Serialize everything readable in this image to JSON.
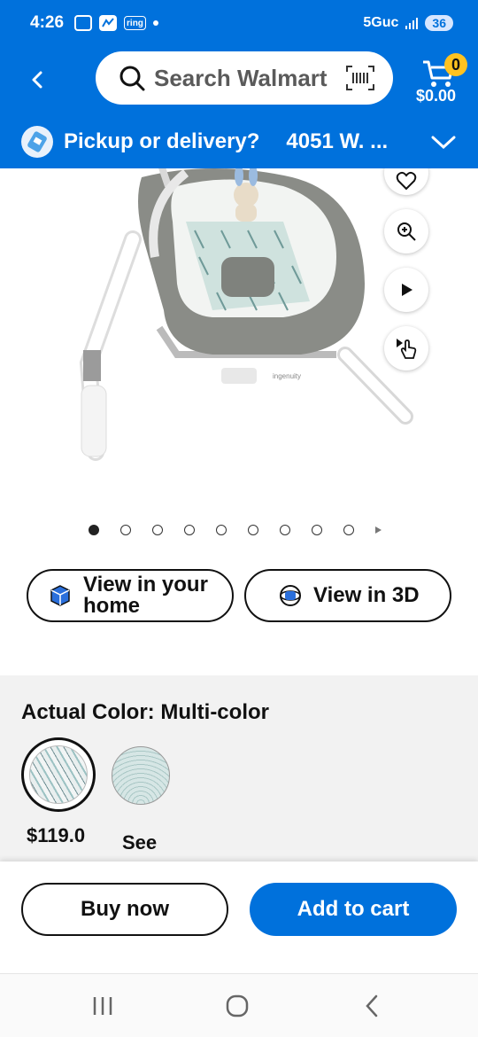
{
  "status_bar": {
    "time": "4:26",
    "notification_icons": [
      "screenshot-icon",
      "app-icon",
      "ring-icon",
      "dot-icon"
    ],
    "ring_label": "ring",
    "network": "5Guc",
    "battery": "36"
  },
  "header": {
    "search_label": "Search Walmart",
    "cart_count": "0",
    "cart_total": "$0.00"
  },
  "pickup": {
    "question": "Pickup or delivery?",
    "address": "4051 W. ..."
  },
  "product": {
    "image_alt": "Baby swing product image",
    "brand_mark": "ingenuity"
  },
  "carousel": {
    "total_dots": 9,
    "active_index": 0
  },
  "actions": {
    "view_home_line1": "View in your",
    "view_home_line2": "home",
    "view_3d": "View in 3D"
  },
  "variants": {
    "title": "Actual Color: Multi-color",
    "price": "$119.0",
    "see": "See"
  },
  "bottom": {
    "buy_now": "Buy now",
    "add_to_cart": "Add to cart"
  },
  "colors": {
    "brand_blue": "#0071dc",
    "brand_yellow": "#ffc220"
  }
}
